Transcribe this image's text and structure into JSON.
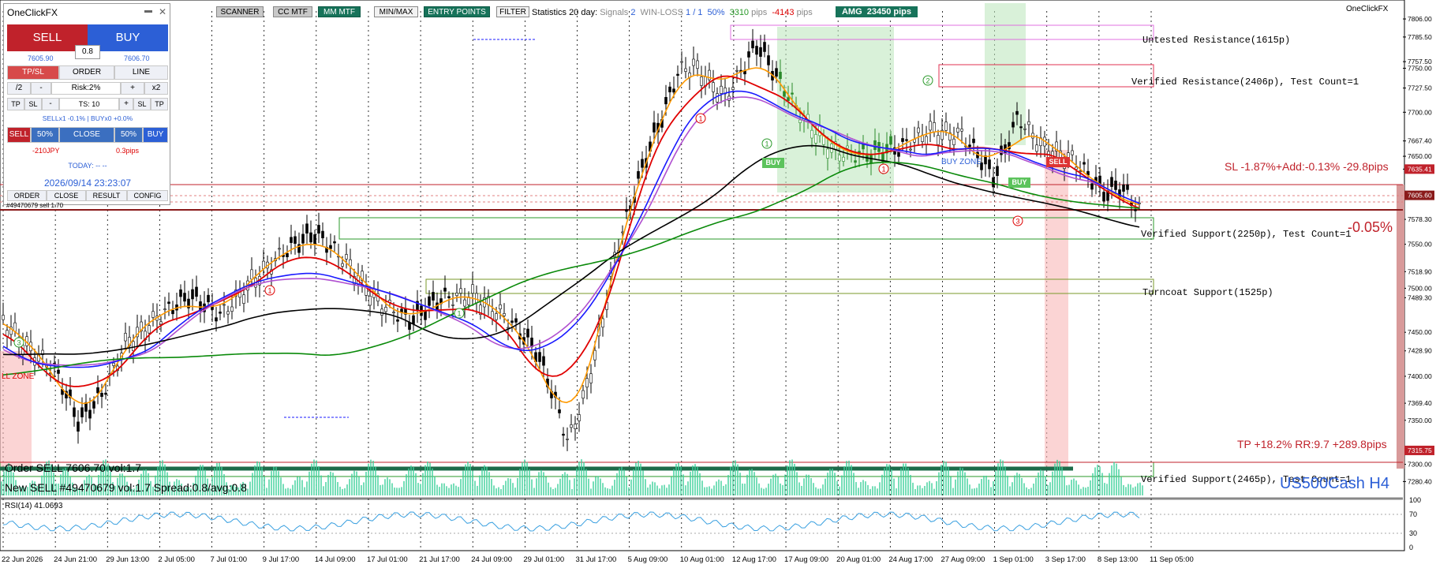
{
  "toolbar": {
    "buttons": [
      {
        "label": "SCANNER",
        "style": "grey"
      },
      {
        "label": "CC MTF",
        "style": "grey"
      },
      {
        "label": "MM MTF",
        "style": "green"
      },
      {
        "label": "MIN/MAX",
        "style": "white"
      },
      {
        "label": "ENTRY POINTS",
        "style": "green"
      },
      {
        "label": "FILTER",
        "style": "white"
      }
    ],
    "stats_label": "Statistics 20 day:",
    "signals_label": "Signals",
    "signals_value": "2",
    "winloss_label": "WIN-LOSS",
    "winloss_value": "1 / 1",
    "winrate": "50%",
    "win_pips": "3310",
    "pips_unit": "pips",
    "loss_pips": "-4143",
    "amg_label": "AMG",
    "amg_value": "23450 pips",
    "brand": "OneClickFX"
  },
  "panel": {
    "title": "OneClickFX",
    "minimize_glyph": "▬",
    "close_glyph": "✕",
    "sell_label": "SELL",
    "buy_label": "BUY",
    "spread": "0.8",
    "bid": "7605.90",
    "ask": "7606.70",
    "tabs": [
      "TP/SL",
      "ORDER",
      "LINE"
    ],
    "half": "/2",
    "minus": "-",
    "risk": "Risk:2%",
    "plus": "+",
    "double": "x2",
    "tp": "TP",
    "sl": "SL",
    "ts_minus": "-",
    "ts": "TS: 10",
    "ts_plus": "+",
    "sl2": "SL",
    "tp2": "TP",
    "pos_info": "SELLx1 -0.1% | BUYx0 +0.0%",
    "close_sell": "SELL",
    "close_50a": "50%",
    "close_all": "CLOSE",
    "close_50b": "50%",
    "close_buy": "BUY",
    "pl_money": "-210JPY",
    "pl_pips": "0.3pips",
    "today": "TODAY: -- --",
    "datetime": "2026/09/14  23:23:07",
    "bottom_tabs": [
      "ORDER",
      "CLOSE",
      "RESULT",
      "CONFIG"
    ],
    "order_ref": "#49470679 sell 1.70"
  },
  "levels": [
    {
      "text": "Untested Resistance(1615p)"
    },
    {
      "text": "Verified Resistance(2406p), Test Count=1"
    },
    {
      "text": "Verified Support(2250p), Test Count=1"
    },
    {
      "text": "Turncoat Support(1525p)"
    },
    {
      "text": "Verified Support(2465p), Test Count=1"
    }
  ],
  "sl_text": "SL -1.87%+Add:-0.13% -29.8pips",
  "tp_text": "TP +18.2% RR:9.7 +289.8pips",
  "pct_change": "-0.05%",
  "symbol": "US500Cash H4",
  "order_line": "Order SELL 7606.70 vol:1.7",
  "new_sell_line": "New SELL #49470679 vol:1.7 Spread:0.8/avg:0.8",
  "zone_labels": {
    "buy_zone": "BUY ZONE",
    "sell_zone": "LL ZONE",
    "sell_arrow": "SELL",
    "buy_arrow": "BUY",
    "buy_arrow2": "BUY"
  },
  "rsi_label": "RSI(14) 41.0693",
  "rsi_ticks": [
    "70",
    "30"
  ],
  "rsi_max": "100",
  "rsi_min": "0",
  "price_axis": [
    "7806.00",
    "7785.50",
    "7757.50",
    "7750.00",
    "7727.50",
    "7700.00",
    "7667.40",
    "7650.00",
    "7635.41",
    "7605.60",
    "7578.30",
    "7550.00",
    "7518.90",
    "7500.00",
    "7489.30",
    "7450.00",
    "7428.90",
    "7400.00",
    "7369.40",
    "7350.00",
    "7315.75",
    "7300.00",
    "7280.40"
  ],
  "time_axis": [
    "22 Jun 2026",
    "24 Jun 21:00",
    "29 Jun 13:00",
    "2 Jul 05:00",
    "7 Jul 01:00",
    "9 Jul 17:00",
    "14 Jul 09:00",
    "17 Jul 01:00",
    "21 Jul 17:00",
    "24 Jul 09:00",
    "29 Jul 01:00",
    "31 Jul 17:00",
    "5 Aug 09:00",
    "10 Aug 01:00",
    "12 Aug 17:00",
    "17 Aug 09:00",
    "20 Aug 01:00",
    "24 Aug 17:00",
    "27 Aug 09:00",
    "1 Sep 01:00",
    "3 Sep 17:00",
    "8 Sep 13:00",
    "11 Sep 05:00"
  ],
  "colors": {
    "sell": "#c0222b",
    "buy": "#2c5fd6",
    "green_btn": "#17735a",
    "ema_red": "#e00000",
    "ema_orange": "#ff9900",
    "ema_blue": "#1a1aff",
    "ema_violet": "#b050d0",
    "ema_black": "#000000",
    "ema_green": "#0a8a0a"
  }
}
